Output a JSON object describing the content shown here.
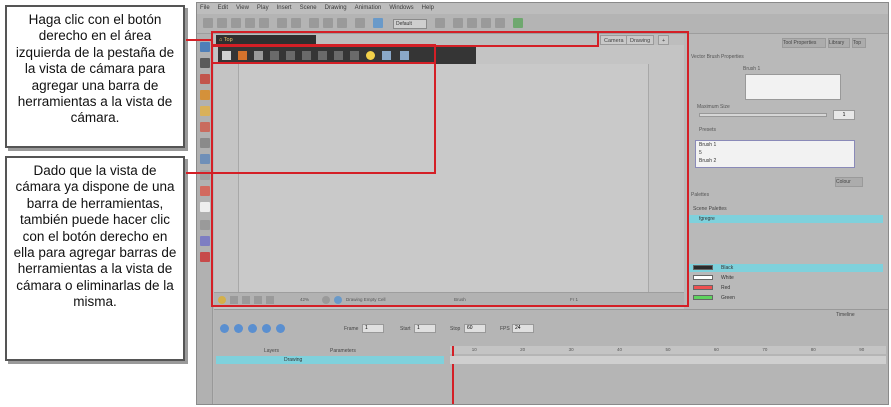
{
  "callouts": {
    "first": "Haga clic con el botón derecho en el área izquierda de la pestaña de la vista de cámara para agregar una barra de herramientas a la vista de cámara.",
    "second": "Dado que la vista de cámara ya dispone de una barra de herramientas, también puede hacer clic con el botón derecho en ella para agregar barras de herramientas a la vista de cámara o eliminarlas de la misma."
  },
  "menu": [
    "File",
    "Edit",
    "View",
    "Play",
    "Insert",
    "Scene",
    "Drawing",
    "Animation",
    "Windows",
    "Help"
  ],
  "toolbar": {
    "workspace_value": "Default"
  },
  "view": {
    "top_tab": "Top",
    "tabs": [
      "Camera",
      "Drawing"
    ]
  },
  "statusbar": {
    "zoom": "42%",
    "drawing": "Drawing Empty Cell",
    "tool": "Brush",
    "frame": "Fr 1"
  },
  "right_panel": {
    "tabs": [
      "Tool Properties",
      "Library",
      "Top"
    ],
    "section_title": "Vector Brush Properties",
    "brush_label": "Brush 1",
    "max_size_label": "Maximum Size",
    "max_size_value": "1",
    "presets_label": "Presets",
    "presets": [
      "Brush 1",
      "5",
      "Brush 2"
    ],
    "colour_tab": "Colour",
    "palettes_label": "Palettes",
    "scene_palettes_label": "Scene Palettes",
    "palette_name": "fgregre",
    "colors": [
      {
        "name": "Black",
        "hex": "#2b2b2b"
      },
      {
        "name": "White",
        "hex": "#ffffff"
      },
      {
        "name": "Red",
        "hex": "#ee5050"
      },
      {
        "name": "Green",
        "hex": "#5ed35e"
      }
    ]
  },
  "timeline": {
    "tab": "Timeline",
    "frame_label": "Frame",
    "frame_value": "1",
    "start_label": "Start",
    "start_value": "1",
    "stop_label": "Stop",
    "stop_value": "60",
    "fps_label": "FPS",
    "fps_value": "24",
    "layers_label": "Layers",
    "params_label": "Parameters",
    "layer_name": "Drawing",
    "ruler": [
      "10",
      "20",
      "30",
      "40",
      "50",
      "60",
      "70",
      "80",
      "90"
    ]
  },
  "colors": {
    "highlight": "#d41f26",
    "selection": "#7fd1dc",
    "dark_bar": "#353535"
  }
}
